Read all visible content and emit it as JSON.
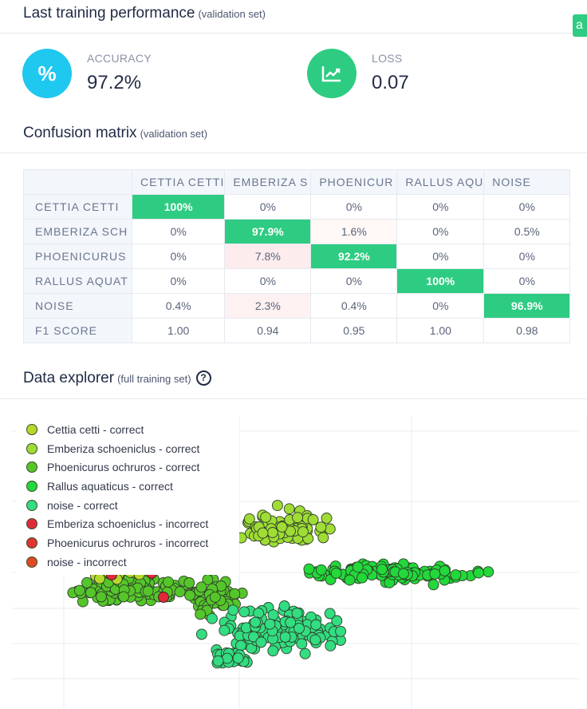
{
  "performance": {
    "title": "Last training performance",
    "subtitle": "(validation set)",
    "accuracy": {
      "label": "ACCURACY",
      "value": "97.2%",
      "icon": "percent-icon",
      "color": "#1ec8ef"
    },
    "loss": {
      "label": "LOSS",
      "value": "0.07",
      "icon": "trend-chart-icon",
      "color": "#2ecc82"
    }
  },
  "confusion": {
    "title": "Confusion matrix",
    "subtitle": "(validation set)",
    "columns": [
      "CETTIA CETTI",
      "EMBERIZA S",
      "PHOENICUR",
      "RALLUS AQU",
      "NOISE"
    ],
    "rows": [
      {
        "label": "CETTIA CETTI",
        "cells": [
          "100%",
          "0%",
          "0%",
          "0%",
          "0%"
        ]
      },
      {
        "label": "EMBERIZA SCH",
        "cells": [
          "0%",
          "97.9%",
          "1.6%",
          "0%",
          "0.5%"
        ]
      },
      {
        "label": "PHOENICURUS",
        "cells": [
          "0%",
          "7.8%",
          "92.2%",
          "0%",
          "0%"
        ]
      },
      {
        "label": "RALLUS AQUAT",
        "cells": [
          "0%",
          "0%",
          "0%",
          "100%",
          "0%"
        ]
      },
      {
        "label": "NOISE",
        "cells": [
          "0.4%",
          "2.3%",
          "0.4%",
          "0%",
          "96.9%"
        ]
      },
      {
        "label": "F1 SCORE",
        "cells": [
          "1.00",
          "0.94",
          "0.95",
          "1.00",
          "0.98"
        ]
      }
    ]
  },
  "explorer": {
    "title": "Data explorer",
    "subtitle": "(full training set)",
    "help_icon": "question-circle-icon",
    "legend": [
      {
        "label": "Cettia cetti - correct",
        "color": "#b5d92a"
      },
      {
        "label": "Emberiza schoeniclus  - correct",
        "color": "#9fdc35"
      },
      {
        "label": "Phoenicurus ochruros - correct",
        "color": "#55c62a"
      },
      {
        "label": "Rallus aquaticus - correct",
        "color": "#22d83a"
      },
      {
        "label": "noise - correct",
        "color": "#33dd82"
      },
      {
        "label": "Emberiza schoeniclus  - incorrect",
        "color": "#e02a3a"
      },
      {
        "label": "Phoenicurus ochruros - incorrect",
        "color": "#e03530"
      },
      {
        "label": "noise - incorrect",
        "color": "#e04a22"
      }
    ]
  },
  "corner_badge": "a"
}
